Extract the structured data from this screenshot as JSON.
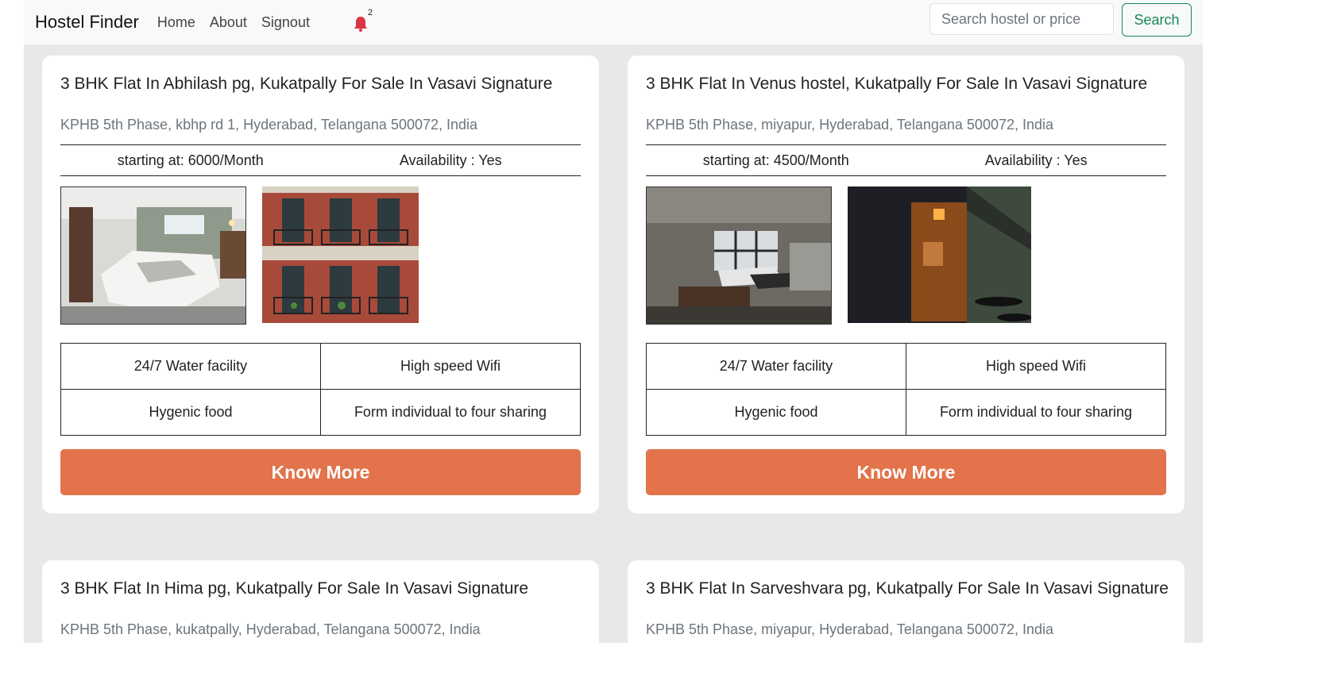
{
  "navbar": {
    "brand": "Hostel Finder",
    "links": [
      "Home",
      "About",
      "Signout"
    ],
    "notification_count": "2",
    "search_placeholder": "Search hostel or price",
    "search_button": "Search"
  },
  "colors": {
    "accent": "#e2734a",
    "search_green": "#198754",
    "bell_red": "#dc3545"
  },
  "cards": [
    {
      "title": "3 BHK Flat In Abhilash pg, Kukatpally For Sale In Vasavi Signature",
      "address": "KPHB 5th Phase, kbhp rd 1, Hyderabad, Telangana 500072, India",
      "price": "starting at:  6000/Month",
      "availability": "Availability : Yes",
      "images": [
        "bedroom-photo",
        "building-facade-photo"
      ],
      "amenities": [
        "24/7 Water facility",
        "High speed Wifi",
        "Hygenic food",
        "Form individual to four sharing"
      ],
      "button": "Know More"
    },
    {
      "title": "3 BHK Flat In Venus hostel, Kukatpally For Sale In Vasavi Signature",
      "address": "KPHB 5th Phase, miyapur, Hyderabad, Telangana 500072, India",
      "price": "starting at:  4500/Month",
      "availability": "Availability : Yes",
      "images": [
        "studio-room-photo",
        "door-light-photo"
      ],
      "amenities": [
        "24/7 Water facility",
        "High speed Wifi",
        "Hygenic food",
        "Form individual to four sharing"
      ],
      "button": "Know More"
    },
    {
      "title": "3 BHK Flat In Hima pg, Kukatpally For Sale In Vasavi Signature",
      "address": "KPHB 5th Phase, kukatpally, Hyderabad, Telangana 500072, India"
    },
    {
      "title": "3 BHK Flat In Sarveshvara pg, Kukatpally For Sale In Vasavi Signature",
      "address": "KPHB 5th Phase, miyapur, Hyderabad, Telangana 500072, India"
    }
  ]
}
